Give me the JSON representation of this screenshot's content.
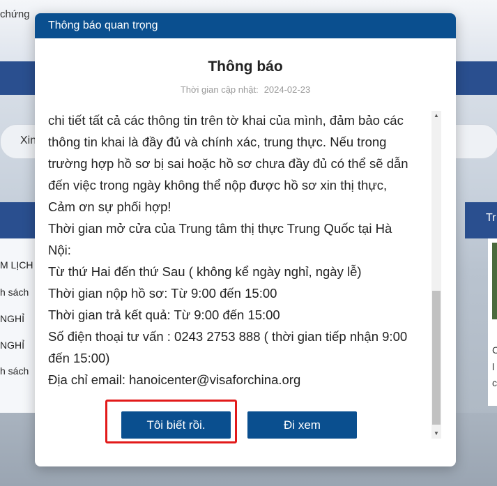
{
  "background": {
    "nav_text": "chứng",
    "search_label": "Xin",
    "right_header": "Tr",
    "left_items": [
      "M LỊCH",
      "h sách",
      "NGHỈ",
      "NGHỈ",
      "h sách"
    ],
    "right_card_lines": [
      "C",
      "l",
      "c"
    ]
  },
  "modal": {
    "header_title": "Thông báo quan trọng",
    "notice_title": "Thông báo",
    "update_label": "Thời gian cập nhật:",
    "update_date": "2024-02-23",
    "content_lines": [
      "chi tiết tất cả các thông tin trên tờ khai của mình, đảm bảo các",
      "thông tin khai là đầy đủ và chính xác, trung thực. Nếu trong",
      "trường hợp hồ sơ bị sai hoặc hồ sơ chưa đầy đủ có thể sẽ dẫn",
      "đến việc trong ngày không thể nộp được hồ sơ xin thị thực,",
      "Cảm ơn sự phối hợp!",
      "Thời gian mở cửa của Trung tâm thị thực Trung Quốc tại Hà",
      "Nội:",
      "Từ thứ Hai đến thứ Sau ( không kể ngày nghỉ, ngày lễ)",
      "Thời gian nộp hồ sơ: Từ 9:00 đến 15:00",
      "Thời gian trả kết quả: Từ 9:00 đến 15:00",
      "Số điện thoại tư vấn : 0243 2753 888  ( thời gian tiếp nhận 9:00",
      "đến 15:00)",
      "Địa chỉ email: hanoicenter@visaforchina.org"
    ],
    "ok_button": "Tôi biết rồi.",
    "go_button": "Đi xem",
    "scroll_up_icon": "▲",
    "scroll_down_icon": "▼"
  },
  "colors": {
    "header_blue": "#0a4f8f",
    "highlight_red": "#e21a1a"
  }
}
